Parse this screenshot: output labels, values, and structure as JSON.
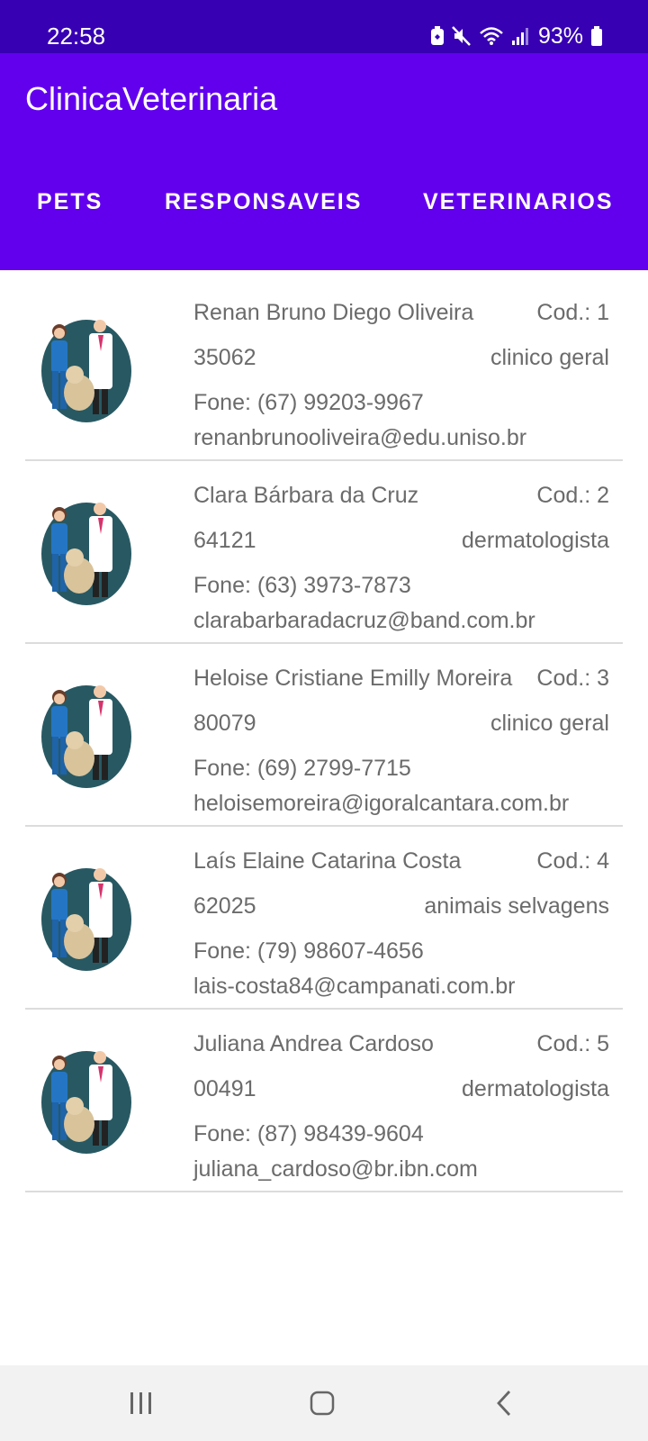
{
  "status_bar": {
    "time": "22:58",
    "battery": "93%",
    "icons": [
      "battery-saver-icon",
      "mute-icon",
      "wifi-icon",
      "signal-icon",
      "battery-icon"
    ]
  },
  "app_bar": {
    "title": "ClinicaVeterinaria",
    "tabs": [
      {
        "label": "PETS"
      },
      {
        "label": "RESPONSAVEIS"
      },
      {
        "label": "VETERINARIOS"
      }
    ],
    "color": "#6200ee"
  },
  "veterinarians": [
    {
      "name": "Renan Bruno Diego Oliveira",
      "code": "Cod.: 1",
      "crmv": "35062",
      "specialty": "clinico geral",
      "phone": "Fone: (67) 99203-9967",
      "email": "renanbrunooliveira@edu.uniso.br"
    },
    {
      "name": "Clara Bárbara da Cruz",
      "code": "Cod.: 2",
      "crmv": "64121",
      "specialty": "dermatologista",
      "phone": "Fone: (63) 3973-7873",
      "email": "clarabarbaradacruz@band.com.br"
    },
    {
      "name": "Heloise Cristiane Emilly Moreira",
      "code": "Cod.: 3",
      "crmv": "80079",
      "specialty": "clinico geral",
      "phone": "Fone: (69) 2799-7715",
      "email": "heloisemoreira@igoralcantara.com.br"
    },
    {
      "name": "Laís Elaine Catarina Costa",
      "code": "Cod.: 4",
      "crmv": "62025",
      "specialty": "animais selvagens",
      "phone": "Fone: (79) 98607-4656",
      "email": "lais-costa84@campanati.com.br"
    },
    {
      "name": "Juliana Andrea Cardoso",
      "code": "Cod.: 5",
      "crmv": "00491",
      "specialty": "dermatologista",
      "phone": "Fone: (87) 98439-9604",
      "email": "juliana_cardoso@br.ibn.com"
    }
  ],
  "nav_bar": {
    "buttons": [
      "recent-apps-icon",
      "home-icon",
      "back-icon"
    ]
  }
}
